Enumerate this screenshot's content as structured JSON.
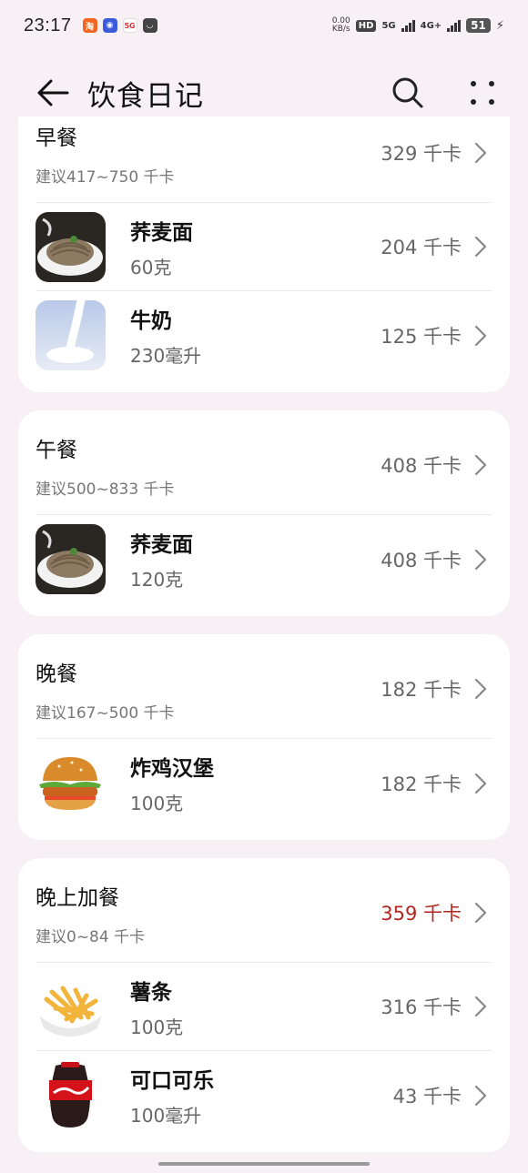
{
  "status": {
    "time": "23:17",
    "net_speed_value": "0.00",
    "net_speed_unit": "KB/s",
    "hd_badge": "HD",
    "sim1": "5G",
    "sim2": "4G+",
    "battery": "51"
  },
  "header": {
    "title": "饮食日记"
  },
  "meals": [
    {
      "name": "早餐",
      "suggestion": "建议417~750 千卡",
      "kcal": "329 千卡",
      "foods": [
        {
          "name": "荞麦面",
          "amount": "60克",
          "kcal": "204 千卡",
          "icon": "soba-noodles"
        },
        {
          "name": "牛奶",
          "amount": "230毫升",
          "kcal": "125 千卡",
          "icon": "milk"
        }
      ]
    },
    {
      "name": "午餐",
      "suggestion": "建议500~833 千卡",
      "kcal": "408 千卡",
      "foods": [
        {
          "name": "荞麦面",
          "amount": "120克",
          "kcal": "408 千卡",
          "icon": "soba-noodles"
        }
      ]
    },
    {
      "name": "晚餐",
      "suggestion": "建议167~500 千卡",
      "kcal": "182 千卡",
      "foods": [
        {
          "name": "炸鸡汉堡",
          "amount": "100克",
          "kcal": "182 千卡",
          "icon": "chicken-burger"
        }
      ]
    },
    {
      "name": "晚上加餐",
      "suggestion": "建议0~84 千卡",
      "kcal": "359 千卡",
      "kcal_over_limit": true,
      "foods": [
        {
          "name": "薯条",
          "amount": "100克",
          "kcal": "316 千卡",
          "icon": "french-fries"
        },
        {
          "name": "可口可乐",
          "amount": "100毫升",
          "kcal": "43 千卡",
          "icon": "cola-bottle"
        }
      ]
    }
  ],
  "colors": {
    "background": "#f7f1f5",
    "card": "#ffffff",
    "over_limit": "#b3261e",
    "secondary_text": "#666666"
  }
}
